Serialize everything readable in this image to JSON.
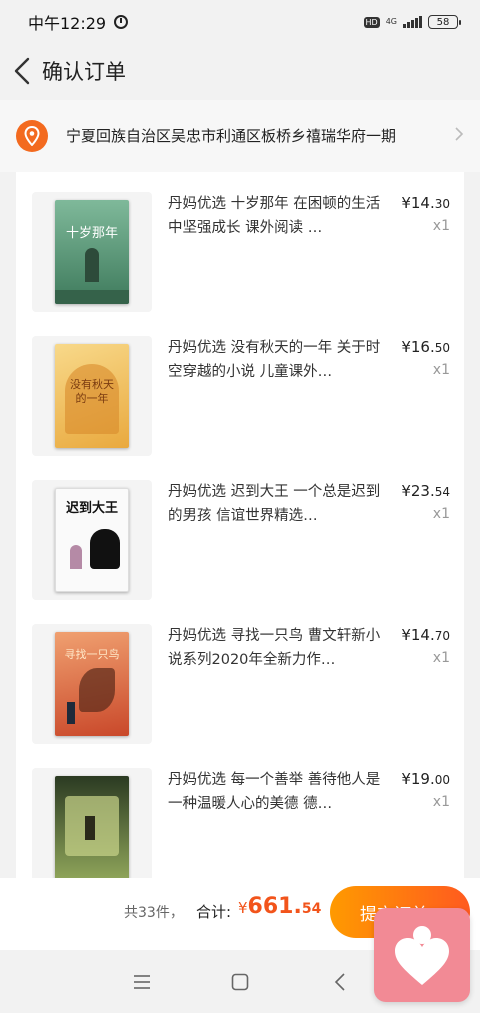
{
  "status_bar": {
    "time": "中午12:29",
    "hd": "HD",
    "network": "4G",
    "battery": "58"
  },
  "header": {
    "title": "确认订单"
  },
  "address": {
    "text": "宁夏回族自治区吴忠市利通区板桥乡禧瑞华府一期"
  },
  "items": [
    {
      "name": "丹妈优选 十岁那年 在困顿的生活中坚强成长 课外阅读 …",
      "price_int": "¥14.",
      "price_dec": "30",
      "qty": "x1",
      "cover_text": "十岁那年",
      "cover_bg": "#4e8e6c"
    },
    {
      "name": "丹妈优选 没有秋天的一年 关于时空穿越的小说 儿童课外…",
      "price_int": "¥16.",
      "price_dec": "50",
      "qty": "x1",
      "cover_text": "没有秋天的一年",
      "cover_bg": "#f0c05a"
    },
    {
      "name": "丹妈优选 迟到大王 一个总是迟到的男孩 信谊世界精选…",
      "price_int": "¥23.",
      "price_dec": "54",
      "qty": "x1",
      "cover_text": "迟到大王",
      "cover_bg": "#fafafa"
    },
    {
      "name": "丹妈优选 寻找一只鸟 曹文轩新小说系列2020年全新力作…",
      "price_int": "¥14.",
      "price_dec": "70",
      "qty": "x1",
      "cover_text": "寻找一只鸟",
      "cover_bg": "#d9643a"
    },
    {
      "name": "丹妈优选 每一个善举 善待他人是一种温暖人心的美德 德…",
      "price_int": "¥19.",
      "price_dec": "00",
      "qty": "x1",
      "cover_text": "",
      "cover_bg": "#6f8a4a"
    }
  ],
  "summary": {
    "count": "共33件，",
    "total_label": "合计:",
    "currency": "¥",
    "total_int": "661.",
    "total_dec": "54",
    "submit_label": "提交订单"
  },
  "colors": {
    "accent": "#f2541b",
    "button_start": "#ff9a00",
    "button_end": "#ff5a1f"
  },
  "icons": [
    "alarm-icon",
    "signal-icon",
    "battery-icon",
    "back-arrow-icon",
    "location-pin-icon",
    "chevron-right-icon",
    "menu-icon",
    "home-icon",
    "back-nav-icon",
    "heart-icon"
  ]
}
